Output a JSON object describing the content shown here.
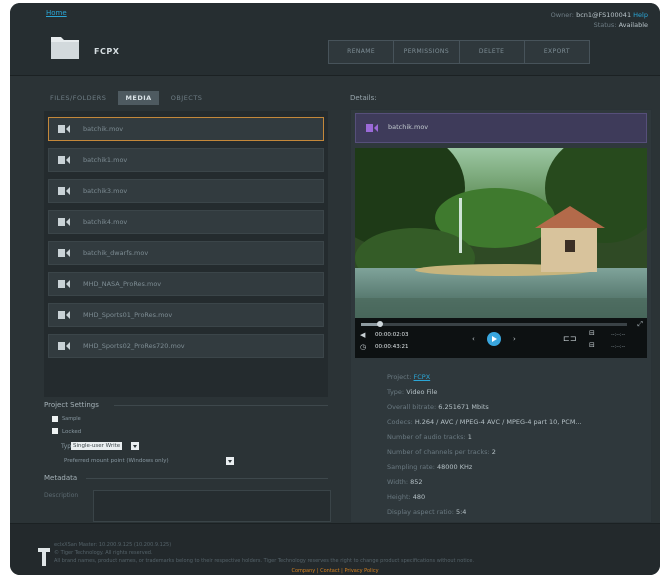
{
  "header": {
    "home_link": "Home",
    "owner_label": "Owner:",
    "owner_value": "bcn1@FS100041",
    "help_link": "Help",
    "status_label": "Status:",
    "status_value": "Available",
    "title": "FCPX",
    "actions": [
      "RENAME",
      "PERMISSIONS",
      "DELETE",
      "EXPORT"
    ]
  },
  "tabs": [
    "FILES/FOLDERS",
    "MEDIA",
    "OBJECTS"
  ],
  "details_label": "Details:",
  "files": [
    "batchik.mov",
    "batchik1.mov",
    "batchik3.mov",
    "batchik4.mov",
    "batchik_dwarfs.mov",
    "MHD_NASA_ProRes.mov",
    "MHD_Sports01_ProRes.mov",
    "MHD_Sports02_ProRes720.mov"
  ],
  "project_settings": {
    "heading": "Project Settings",
    "sample_label": "Sample",
    "locked_label": "Locked",
    "type_label": "Type",
    "type_value": "Single-user Write",
    "mount_label": "Preferred mount point (Windows only)",
    "mount_value": ""
  },
  "metadata": {
    "heading": "Metadata",
    "description_label": "Description"
  },
  "details": {
    "file_name": "batchik.mov",
    "timecode_current": "00:00:02:03",
    "timecode_total": "00:00:43:21",
    "dash_a": "--:--:--",
    "dash_b": "--:--:--",
    "info": [
      {
        "label": "Project:",
        "value": "FCPX",
        "link": true
      },
      {
        "label": "Type:",
        "value": "Video File"
      },
      {
        "label": "Overall bitrate:",
        "value": "6.251671 Mbits"
      },
      {
        "label": "Codecs:",
        "value": "H.264 / AVC / MPEG-4 AVC / MPEG-4 part 10, PCM..."
      },
      {
        "label": "Number of audio tracks:",
        "value": "1"
      },
      {
        "label": "Number of channels per tracks:",
        "value": "2"
      },
      {
        "label": "Sampling rate:",
        "value": "48000 KHz"
      },
      {
        "label": "Width:",
        "value": "852"
      },
      {
        "label": "Height:",
        "value": "480"
      },
      {
        "label": "Display aspect ratio:",
        "value": "5:4"
      }
    ],
    "progress": 0.07
  },
  "footer": {
    "line1": "eclxXSan Master: 10.200.9.125 (10.200.9.125)",
    "line2": "© Tiger Technology. All rights reserved.",
    "line3": "All brand names, product names, or trademarks belong to their respective holders. Tiger Technology reserves the right to change product specifications without notice.",
    "links": [
      "Company",
      "Contact",
      "Privacy Policy"
    ]
  },
  "colors": {
    "accent": "#2aa6d6",
    "selection_border": "#c4883a",
    "footer_links": "#d78320"
  }
}
